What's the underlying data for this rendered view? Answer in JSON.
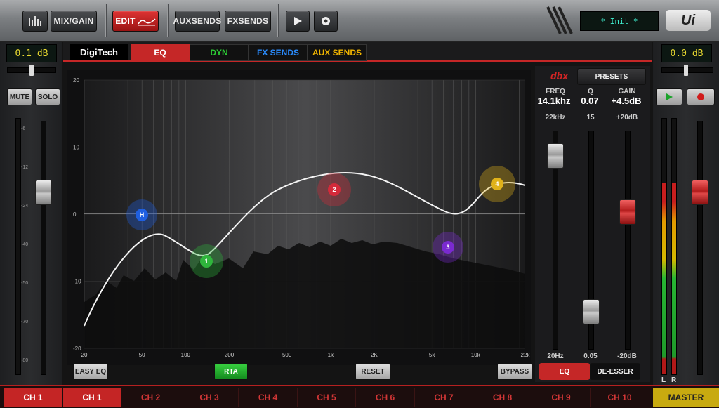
{
  "toolbar": {
    "mix_gain": "MIX/GAIN",
    "edit": "EDIT",
    "aux_sends": "AUXSENDS",
    "fx_sends": "FXSENDS",
    "lcd_text": "* Init *",
    "brand_logo": "Ui"
  },
  "left_strip": {
    "gain_readout": "0.1 dB",
    "mute": "MUTE",
    "solo": "SOLO",
    "meter_scale": [
      "-6",
      "-12",
      "-24",
      "-40",
      "-50",
      "-70",
      "-80"
    ],
    "meter_level": 0.0,
    "fader_level": 0.72
  },
  "right_strip": {
    "gain_readout": "0.0 dB",
    "play_icon": "play-icon",
    "record_icon": "record-icon",
    "left_label": "L",
    "right_label": "R",
    "meter_level": 0.75,
    "fader_level": 0.72
  },
  "tabs": {
    "brand": "DigiTech",
    "eq": "EQ",
    "dyn": "DYN",
    "fx_sends": "FX SENDS",
    "aux_sends": "AUX SENDS"
  },
  "eq_plot": {
    "y_ticks": [
      "20",
      "10",
      "0",
      "-10",
      "-20"
    ],
    "x_ticks": [
      "20",
      "50",
      "100",
      "200",
      "500",
      "1k",
      "2K",
      "5k",
      "10k",
      "22k"
    ],
    "bands": [
      {
        "label": "H",
        "color": "#1f5fe0"
      },
      {
        "label": "1",
        "color": "#2fb53c"
      },
      {
        "label": "2",
        "color": "#d42a3a"
      },
      {
        "label": "3",
        "color": "#7a2ad0"
      },
      {
        "label": "4",
        "color": "#e0b21a"
      }
    ]
  },
  "dbx_panel": {
    "logo": "dbx",
    "presets": "PRESETS",
    "freq_label": "FREQ",
    "freq_value": "14.1khz",
    "q_label": "Q",
    "q_value": "0.07",
    "gain_label": "GAIN",
    "gain_value": "+4.5dB",
    "freq_max": "22kHz",
    "freq_min": "20Hz",
    "q_max": "15",
    "q_min": "0.05",
    "gain_max": "+20dB",
    "gain_min": "-20dB",
    "eq_button": "EQ",
    "deesser_button": "DE-ESSER"
  },
  "bottom_buttons": {
    "easy_eq": "EASY EQ",
    "rta": "RTA",
    "reset": "RESET",
    "bypass": "BYPASS"
  },
  "channels": {
    "left_label": "CH 1",
    "items": [
      "CH 1",
      "CH 2",
      "CH 3",
      "CH 4",
      "CH 5",
      "CH 6",
      "CH 7",
      "CH 8",
      "CH 9",
      "CH 10"
    ],
    "master": "MASTER"
  }
}
